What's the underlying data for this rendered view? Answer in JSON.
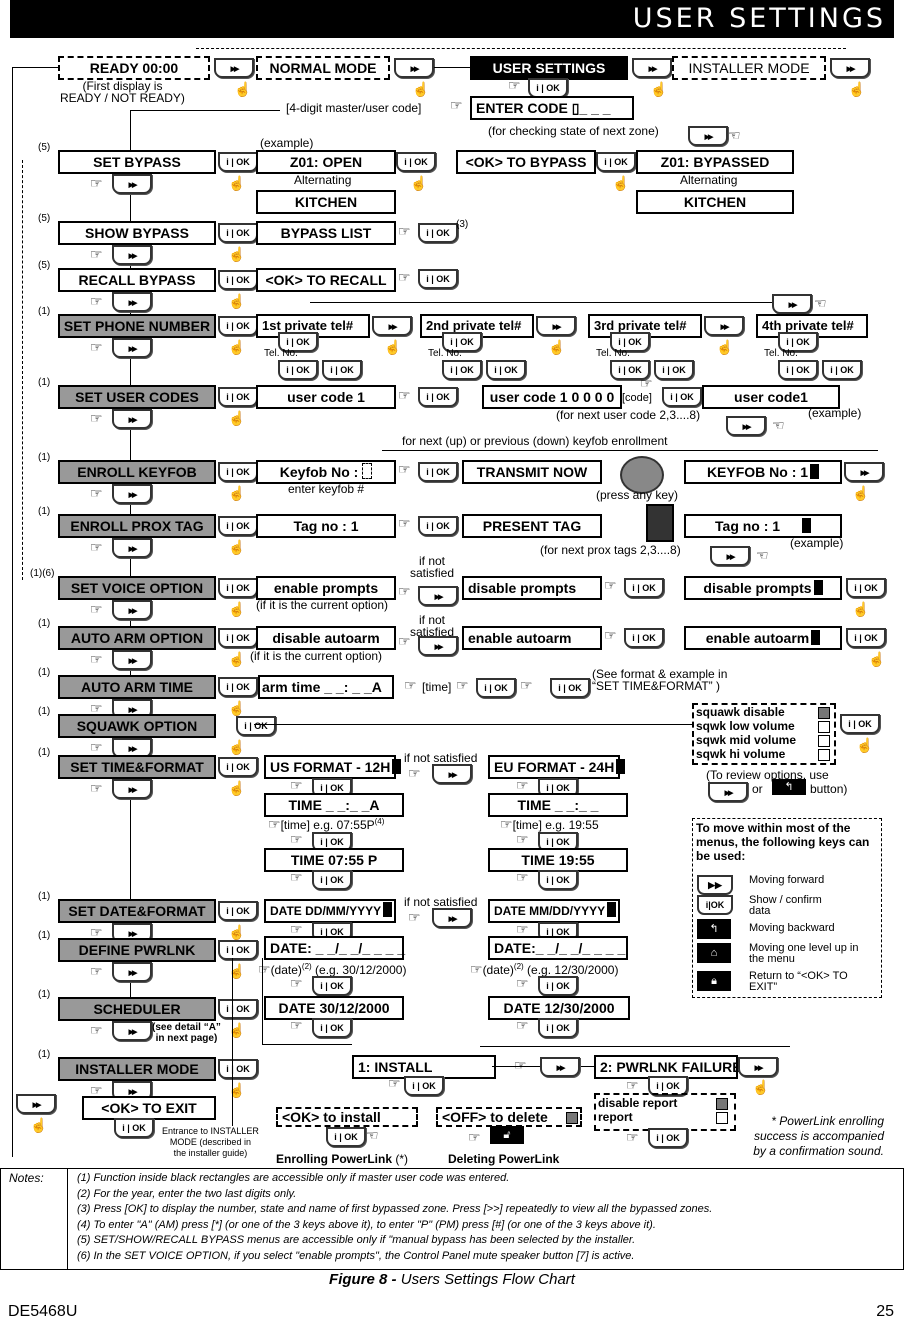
{
  "header": {
    "title": "USER SETTINGS"
  },
  "top": {
    "ready": "READY 00:00",
    "ready_note": "(First display is\nREADY / NOT READY)",
    "normal_mode": "NORMAL MODE",
    "user_settings": "USER SETTINGS",
    "installer_mode": "INSTALLER MODE",
    "enter_code": "ENTER CODE",
    "code_hint": "[4-digit master/user code]",
    "next_zone_note": "(for checking state of next zone)"
  },
  "menu": [
    {
      "label": "SET BYPASS",
      "note": "(5)",
      "master_only": false
    },
    {
      "label": "SHOW BYPASS",
      "note": "(5)",
      "master_only": false
    },
    {
      "label": "RECALL BYPASS",
      "note": "(5)",
      "master_only": false
    },
    {
      "label": "SET PHONE NUMBER",
      "note": "(1)",
      "master_only": true
    },
    {
      "label": "SET USER CODES",
      "note": "(1)",
      "master_only": true
    },
    {
      "label": "ENROLL KEYFOB",
      "note": "(1)",
      "master_only": true
    },
    {
      "label": "ENROLL PROX TAG",
      "note": "(1)",
      "master_only": true
    },
    {
      "label": "SET VOICE OPTION",
      "note": "(1)(6)",
      "master_only": true
    },
    {
      "label": "AUTO ARM OPTION",
      "note": "(1)",
      "master_only": true
    },
    {
      "label": "AUTO ARM TIME",
      "note": "(1)",
      "master_only": true
    },
    {
      "label": "SQUAWK OPTION",
      "note": "(1)",
      "master_only": true
    },
    {
      "label": "SET TIME&FORMAT",
      "note": "(1)",
      "master_only": true
    },
    {
      "label": "SET DATE&FORMAT",
      "note": "(1)",
      "master_only": true
    },
    {
      "label": "DEFINE PWRLNK",
      "note": "(1)",
      "master_only": true
    },
    {
      "label": "SCHEDULER",
      "note": "(1)",
      "master_only": true
    },
    {
      "label": "INSTALLER MODE",
      "note": "(1)",
      "master_only": true
    },
    {
      "label": "<OK> TO EXIT",
      "note": "",
      "master_only": false
    }
  ],
  "bypass": {
    "example": "(example)",
    "z01_open": "Z01: OPEN",
    "alternating": "Alternating",
    "kitchen": "KITCHEN",
    "ok_to_bypass": "<OK> TO BYPASS",
    "z01_bypassed": "Z01: BYPASSED",
    "bypass_list": "BYPASS LIST",
    "note3": "(3)",
    "ok_to_recall": "<OK> TO RECALL"
  },
  "phone": {
    "tels": [
      "1st private tel#",
      "2nd private tel#",
      "3rd private tel#",
      "4th private tel#"
    ],
    "tel_no": "Tel. No."
  },
  "user_codes": {
    "code1": "user code 1",
    "code1_edit": "user code 1 0 0 0 0",
    "code_hint": "[code]",
    "code1_result": "user code1",
    "next_note": "(for next user code 2,3....8)",
    "example": "(example)"
  },
  "keyfob": {
    "top_note": "for next (up) or previous (down)  keyfob enrollment",
    "keyfob_no": "Keyfob No :",
    "enter_note": "enter keyfob #",
    "transmit": "TRANSMIT NOW",
    "press_any": "(press any key)",
    "result": "KEYFOB No : 1"
  },
  "prox": {
    "tag_no": "Tag no   : 1",
    "present": "PRESENT TAG",
    "result": "Tag no   :   1",
    "next_note": "(for next prox tags 2,3....8)",
    "example": "(example)"
  },
  "voice": {
    "enable": "enable prompts",
    "current_note": "(if it is the current option)",
    "if_not": "if not\nsatisfied",
    "disable": "disable prompts",
    "result": "disable prompts"
  },
  "autoarm": {
    "disable": "disable autoarm",
    "current_note": "(if it is the current option)",
    "if_not": "if not\nsatisfied",
    "enable": "enable autoarm",
    "result": "enable autoarm"
  },
  "armtime": {
    "field": "arm time _ _: _ _A",
    "time_hint": "[time]",
    "see_note": "(See format & example in\n“SET TIME&FORMAT” )"
  },
  "squawk": {
    "options": [
      {
        "label": "squawk disable",
        "selected": true
      },
      {
        "label": "sqwk low volume",
        "selected": false
      },
      {
        "label": "sqwk mid volume",
        "selected": false
      },
      {
        "label": "sqwk hi volume",
        "selected": false
      }
    ],
    "review_note_a": "(To review options, use",
    "review_or": "or",
    "review_note_b": "button)"
  },
  "timefmt": {
    "us": "US FORMAT - 12H",
    "if_not": "if not satisfied",
    "eu": "EU FORMAT - 24H",
    "us_time": "TIME _ _:_ _A",
    "eu_time": "TIME _ _:_ _",
    "us_hint": "[time] e.g. 07:55P",
    "us_hint_sup": "(4)",
    "eu_hint": "[time] e.g. 19:55",
    "us_result": "TIME 07:55 P",
    "eu_result": "TIME 19:55"
  },
  "datefmt": {
    "dmy": "DATE DD/MM/YYYY",
    "if_not": "if not satisfied",
    "mdy": "DATE MM/DD/YYYY",
    "dmy_field": "DATE: _ _/_ _/_ _ _ _",
    "mdy_field": "DATE:_ _/_ _/_ _ _ _",
    "dmy_hint": "(date)",
    "dmy_example": "(e.g. 30/12/2000)",
    "mdy_hint": "(date)",
    "mdy_example": "(e.g. 12/30/2000)",
    "sup": "(2)",
    "dmy_result": "DATE 30/12/2000",
    "mdy_result": "DATE 12/30/2000"
  },
  "legend": {
    "title": "To move within most of the menus, the following keys can be used:",
    "items": [
      {
        "icon": "forward-button",
        "label": "Moving forward"
      },
      {
        "icon": "ok-button",
        "label": "Show / confirm data"
      },
      {
        "icon": "back-button",
        "label": "Moving backward"
      },
      {
        "icon": "home-button",
        "label": "Moving one level up in the menu"
      },
      {
        "icon": "lock-button",
        "label": "Return to “<OK> TO EXIT”"
      }
    ]
  },
  "scheduler": {
    "detail_note": "(see detail “A”\nin next page)"
  },
  "installer": {
    "entrance_note": "Entrance to INSTALLER\nMODE (described in\nthe installer guide)"
  },
  "pwrlnk": {
    "install": "1: INSTALL",
    "failure": "2: PWRLNK FAILURE",
    "ok_install": "<OK> to install",
    "off_delete": "<OFF> to delete",
    "disable_report": "disable report",
    "report": "report",
    "enrolling": "Enrolling PowerLink",
    "enrolling_star": "(*)",
    "deleting": "Deleting PowerLink",
    "star_note": "* PowerLink enrolling success is accompanied by a confirmation sound."
  },
  "notes": {
    "head": "Notes:",
    "lines": [
      "(1) Function inside black rectangles are accessible only if master user code was entered.",
      "(2) For the year, enter the two last digits only.",
      "(3) Press [OK] to display the number, state and name of first bypassed zone. Press [>>] repeatedly to view all the bypassed zones.",
      "(4) To enter \"A\" (AM) press [*] (or one of the 3 keys above it), to enter \"P\" (PM) press [#] (or one of the 3 keys above it).",
      "(5) SET/SHOW/RECALL BYPASS menus are accessible only if \"manual bypass has been selected by the installer.",
      "(6) In the SET VOICE OPTION, if you select \"enable prompts\", the Control Panel mute speaker button [7] is active."
    ]
  },
  "caption": {
    "figure": "Figure 8 -",
    "text": " Users Settings Flow Chart"
  },
  "footer": {
    "doc_id": "DE5468U",
    "page": "25"
  }
}
